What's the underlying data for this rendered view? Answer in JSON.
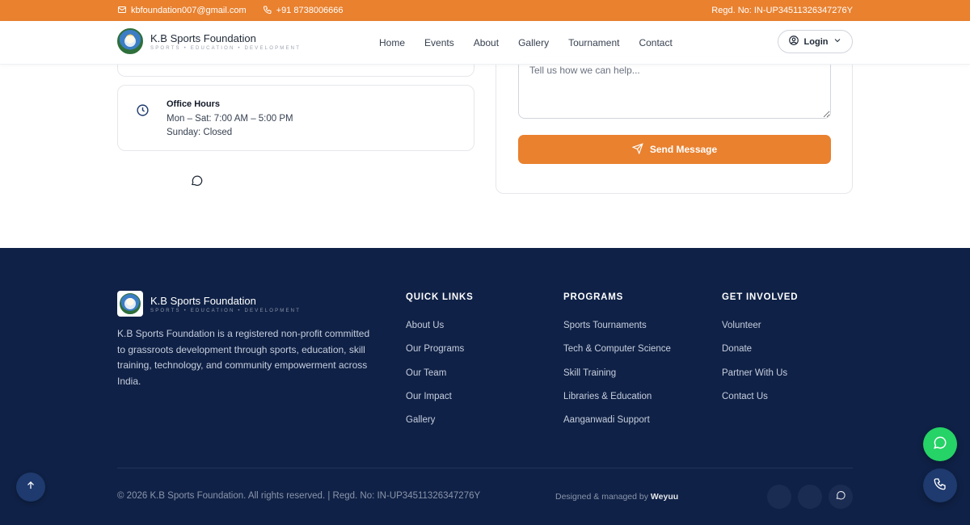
{
  "topbar": {
    "email": "kbfoundation007@gmail.com",
    "phone": "+91 8738006666",
    "regd": "Regd. No: IN-UP34511326347276Y"
  },
  "brand": {
    "name": "K.B Sports Foundation",
    "tagline": "SPORTS • EDUCATION • DEVELOPMENT"
  },
  "nav": {
    "links": [
      "Home",
      "Events",
      "About",
      "Gallery",
      "Tournament",
      "Contact"
    ],
    "login_label": "Login"
  },
  "office_hours": {
    "title": "Office Hours",
    "weekdays": "Mon – Sat: 7:00 AM – 5:00 PM",
    "sunday": "Sunday: Closed"
  },
  "form": {
    "message_placeholder": "Tell us how we can help...",
    "send_label": "Send Message"
  },
  "footer": {
    "description": "K.B Sports Foundation is a registered non-profit committed to grassroots development through sports, education, skill training, technology, and community empowerment across India.",
    "quick_links": {
      "heading": "QUICK LINKS",
      "items": [
        "About Us",
        "Our Programs",
        "Our Team",
        "Our Impact",
        "Gallery"
      ]
    },
    "programs": {
      "heading": "PROGRAMS",
      "items": [
        "Sports Tournaments",
        "Tech & Computer Science",
        "Skill Training",
        "Libraries & Education",
        "Aanganwadi Support"
      ]
    },
    "get_involved": {
      "heading": "GET INVOLVED",
      "items": [
        "Volunteer",
        "Donate",
        "Partner With Us",
        "Contact Us"
      ]
    },
    "copyright": "© 2026 K.B Sports Foundation. All rights reserved. | Regd. No: IN-UP34511326347276Y",
    "designed_prefix": "Designed & managed by",
    "designed_by": "Weyuu"
  },
  "colors": {
    "accent": "#e9812f",
    "footer_bg": "#0f2146",
    "navy": "#1e3a6e",
    "whatsapp": "#25d366"
  },
  "icons": {
    "email": "mail-icon",
    "phone": "phone-icon",
    "user": "user-circle-icon",
    "clock": "clock-icon",
    "send": "send-icon",
    "chat": "chat-bubble-icon",
    "arrow_up": "arrow-up-icon"
  }
}
